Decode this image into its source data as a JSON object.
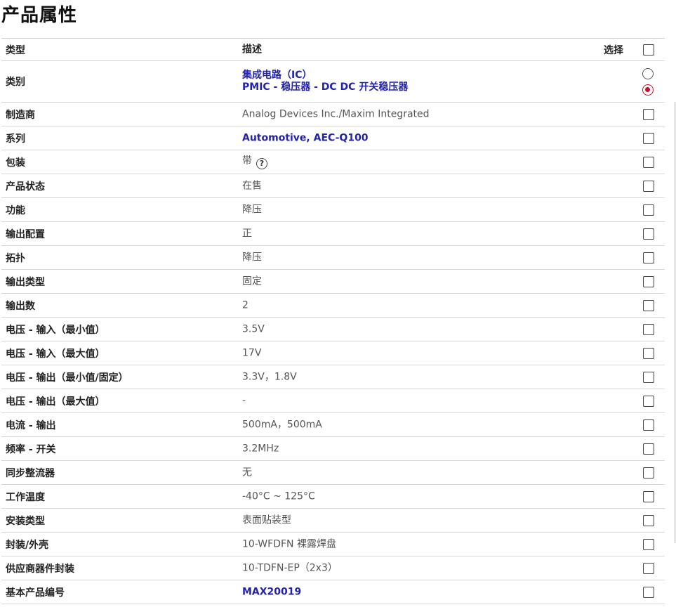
{
  "page": {
    "title": "产品属性"
  },
  "table": {
    "header": {
      "type": "类型",
      "desc": "描述",
      "select": "选择"
    },
    "category": {
      "label": "类别",
      "line1": "集成电路（IC）",
      "line2": "PMIC - 稳压器 - DC DC 开关稳压器"
    },
    "rows": [
      {
        "label": "制造商",
        "value": "Analog Devices Inc./Maxim Integrated"
      },
      {
        "label": "系列",
        "value": "Automotive, AEC-Q100"
      },
      {
        "label": "包装",
        "value": "带"
      },
      {
        "label": "产品状态",
        "value": "在售"
      },
      {
        "label": "功能",
        "value": "降压"
      },
      {
        "label": "输出配置",
        "value": "正"
      },
      {
        "label": "拓扑",
        "value": "降压"
      },
      {
        "label": "输出类型",
        "value": "固定"
      },
      {
        "label": "输出数",
        "value": "2"
      },
      {
        "label": "电压 - 输入（最小值）",
        "value": "3.5V"
      },
      {
        "label": "电压 - 输入（最大值）",
        "value": "17V"
      },
      {
        "label": "电压 - 输出（最小值/固定）",
        "value": "3.3V，1.8V"
      },
      {
        "label": "电压 - 输出（最大值）",
        "value": "-"
      },
      {
        "label": "电流 - 输出",
        "value": "500mA，500mA"
      },
      {
        "label": "频率 - 开关",
        "value": "3.2MHz"
      },
      {
        "label": "同步整流器",
        "value": "无"
      },
      {
        "label": "工作温度",
        "value": "-40°C ~ 125°C"
      },
      {
        "label": "安装类型",
        "value": "表面贴装型"
      },
      {
        "label": "封装/外壳",
        "value": "10-WFDFN 裸露焊盘"
      },
      {
        "label": "供应商器件封装",
        "value": "10-TDFN-EP（2x3）"
      },
      {
        "label": "基本产品编号",
        "value": "MAX20019"
      }
    ],
    "help_icon_glyph": "?"
  }
}
